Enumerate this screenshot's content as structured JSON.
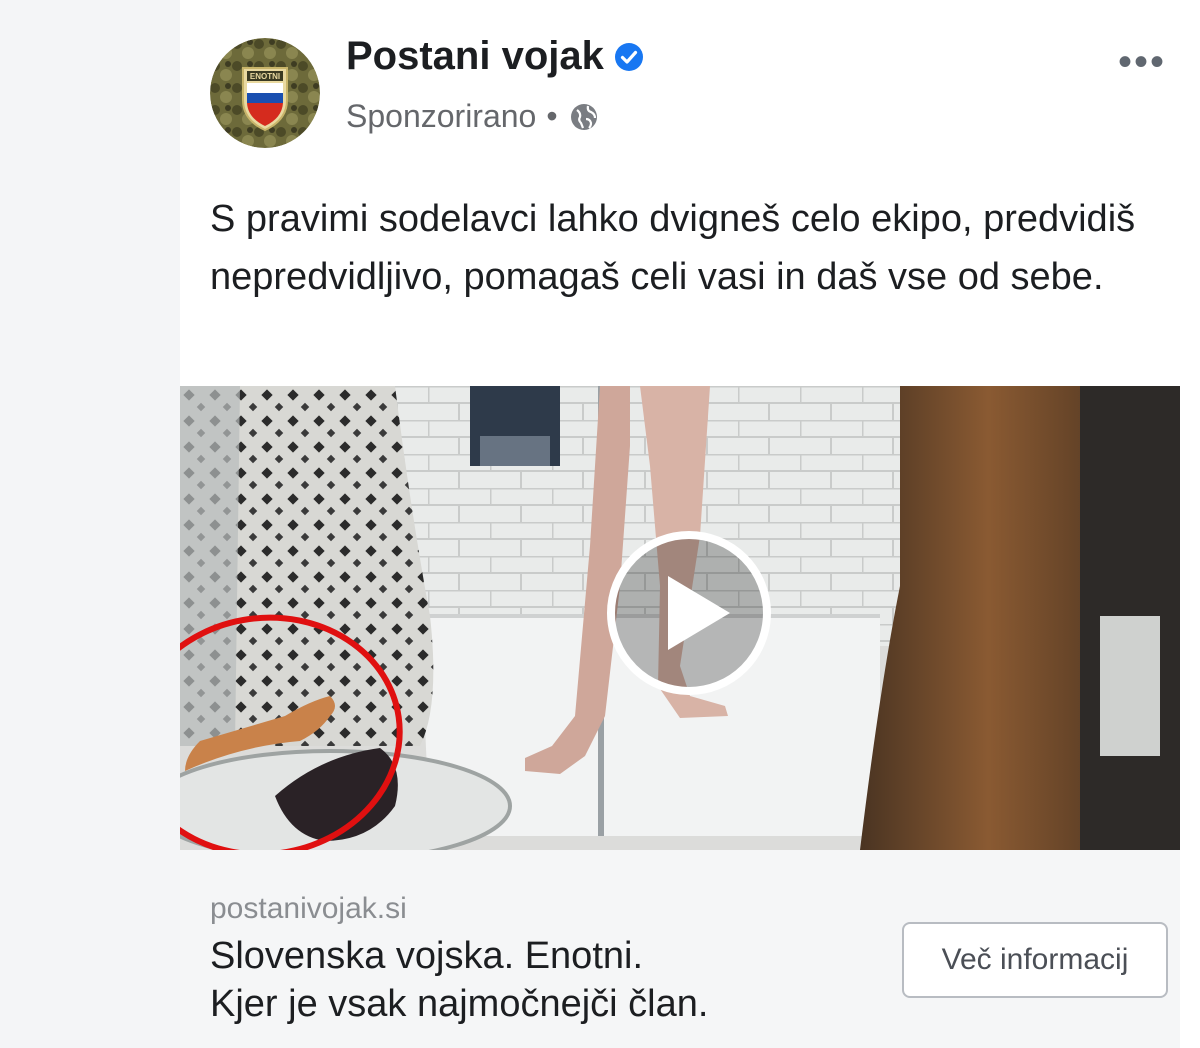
{
  "post": {
    "page_name": "Postani vojak",
    "sponsored_label": "Sponzorirano",
    "separator": "•",
    "text": "S pravimi sodelavci lahko dvigneš celo ekipo, predvidiš nepredvidljivo, pomagaš celi vasi in daš vse od sebe.",
    "more_label": "•••"
  },
  "avatar": {
    "badge_text": "ENOTNI"
  },
  "link": {
    "domain": "postanivojak.si",
    "headline_line1": "Slovenska vojska. Enotni.",
    "headline_line2": "Kjer je vsak najmočnejči član.",
    "cta_label": "Več informacij"
  },
  "icons": {
    "verified": "verified-badge-icon",
    "globe": "globe-icon",
    "play": "play-icon",
    "more": "more-options-icon"
  },
  "colors": {
    "verified_blue": "#1877f2",
    "annotation_red": "#e01010",
    "meta_gray": "#65676b"
  }
}
